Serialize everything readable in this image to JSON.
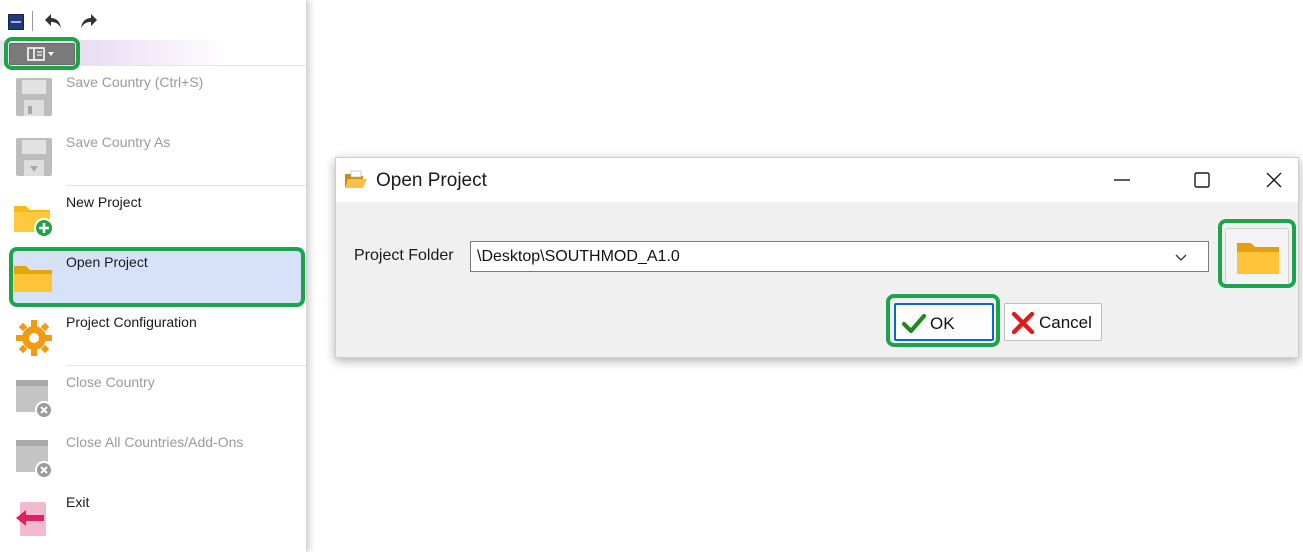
{
  "qat": {
    "undo_icon": "undo-arrow-icon",
    "redo_icon": "redo-arrow-icon"
  },
  "menu": {
    "items": [
      {
        "label": "Save Country  (Ctrl+S)",
        "icon": "floppy-disk-icon",
        "enabled": false
      },
      {
        "label": "Save Country As",
        "icon": "floppy-disk-as-icon",
        "enabled": false
      },
      {
        "label": "New Project",
        "icon": "folder-plus-icon",
        "enabled": true
      },
      {
        "label": "Open Project",
        "icon": "folder-icon",
        "enabled": true,
        "selected": true
      },
      {
        "label": "Project Configuration",
        "icon": "gear-icon",
        "enabled": true
      },
      {
        "label": "Close Country",
        "icon": "close-window-icon",
        "enabled": false
      },
      {
        "label": "Close All Countries/Add-Ons",
        "icon": "close-window-icon",
        "enabled": false
      },
      {
        "label": "Exit",
        "icon": "exit-arrow-icon",
        "enabled": true
      }
    ]
  },
  "dialog": {
    "title": "Open Project",
    "field_label": "Project Folder",
    "folder_value": "\\Desktop\\SOUTHMOD_A1.0",
    "ok_label": "OK",
    "cancel_label": "Cancel"
  },
  "colors": {
    "highlight": "#1fa34a",
    "selection": "#d7e1f8",
    "folder": "#f6b915",
    "ok_check": "#1f8a1f",
    "cancel_x": "#e01b1b",
    "focus_border": "#0a66d8"
  }
}
